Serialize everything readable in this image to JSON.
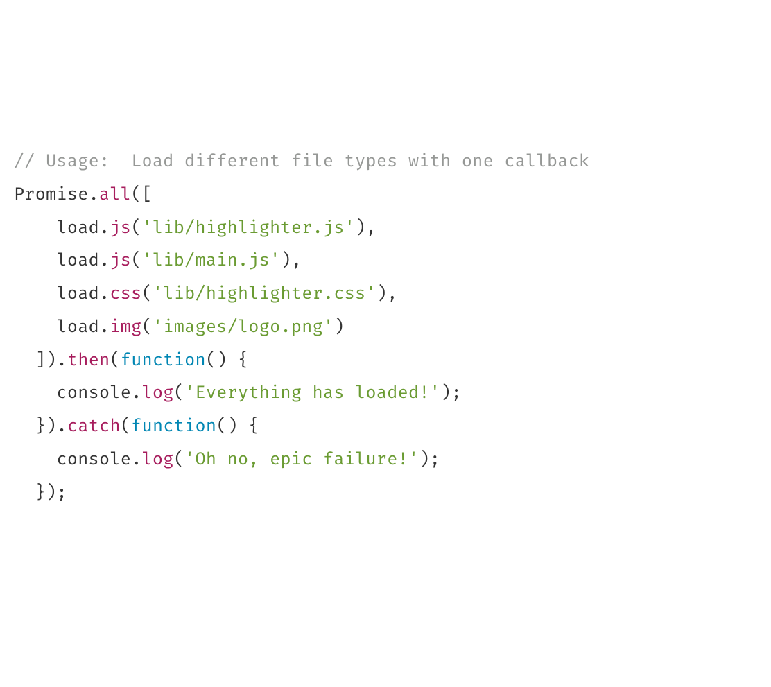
{
  "code": {
    "comment": "// Usage:  Load different file types with one callback",
    "promise": "Promise",
    "dot": ".",
    "all": "all",
    "openParen": "(",
    "openBracket": "[",
    "load": "load",
    "js": "js",
    "css": "css",
    "img": "img",
    "file1": "'lib/highlighter.js'",
    "file2": "'lib/main.js'",
    "file3": "'lib/highlighter.css'",
    "file4": "'images/logo.png'",
    "closeParen": ")",
    "comma": ",",
    "closeBracket": "]",
    "then": "then",
    "catch": "catch",
    "function": "function",
    "funcParens": "()",
    "openBrace": " {",
    "closeBrace": "}",
    "console": "console",
    "log": "log",
    "msg1": "'Everything has loaded!'",
    "msg2": "'Oh no, epic failure!'",
    "semicolon": ";",
    "indent1": "    ",
    "indent2": "  "
  }
}
